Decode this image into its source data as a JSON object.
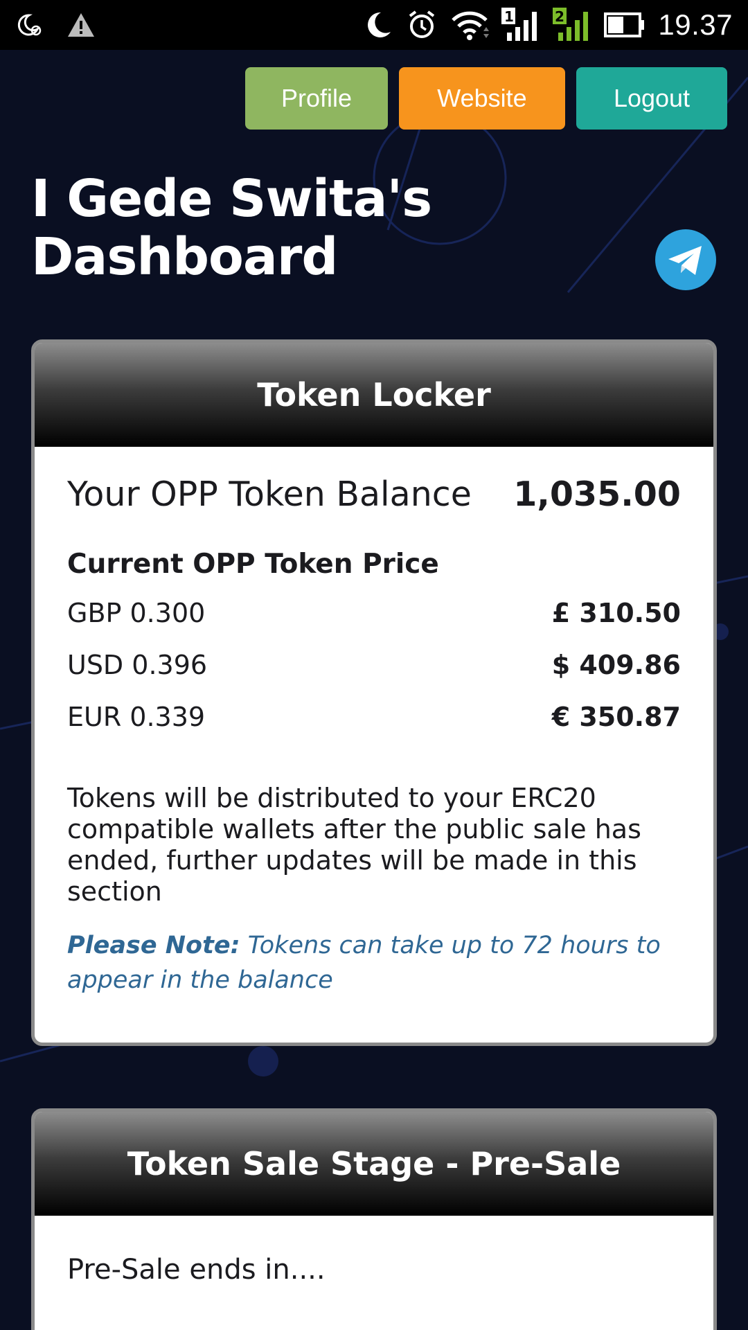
{
  "status_bar": {
    "time": "19.37",
    "sim1": "1",
    "sim2": "2",
    "icons": [
      "do-not-disturb-icon",
      "warning-icon",
      "moon-icon",
      "alarm-icon",
      "wifi-icon",
      "signal-icon",
      "signal-icon",
      "battery-icon"
    ]
  },
  "nav": {
    "profile_label": "Profile",
    "website_label": "Website",
    "logout_label": "Logout"
  },
  "page": {
    "title_line1": "I Gede Swita's",
    "title_line2": "Dashboard"
  },
  "token_locker": {
    "header": "Token Locker",
    "balance_label": "Your OPP Token Balance",
    "balance_value": "1,035.00",
    "price_title": "Current OPP Token Price",
    "prices": [
      {
        "label": "GBP 0.300",
        "value": "£ 310.50"
      },
      {
        "label": "USD 0.396",
        "value": "$ 409.86"
      },
      {
        "label": "EUR 0.339",
        "value": "€ 350.87"
      }
    ],
    "distribution_text": "Tokens will be distributed to your ERC20 compatible wallets after the public sale has ended, further updates will be made in this section",
    "note_label": "Please Note:",
    "note_text": " Tokens can take up to 72 hours to appear in the balance"
  },
  "token_sale": {
    "header": "Token Sale Stage - Pre-Sale",
    "ends_text": "Pre-Sale ends in...."
  },
  "colors": {
    "background": "#0a0f22",
    "profile": "#8fb660",
    "website": "#f7941d",
    "logout": "#1fa898",
    "note": "#2f6794",
    "telegram": "#2ea3dd"
  }
}
